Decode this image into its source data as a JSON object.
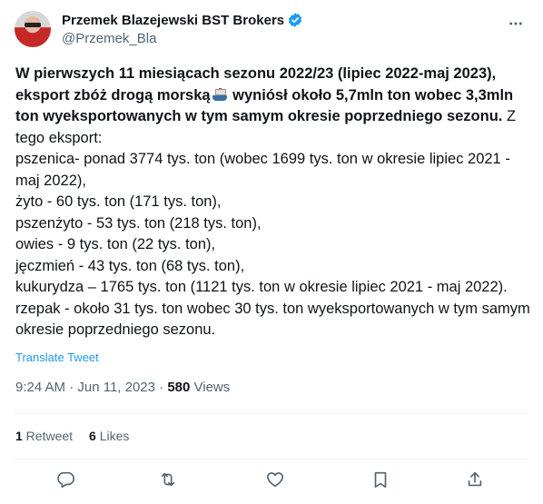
{
  "author": {
    "display_name": "Przemek Blazejewski BST Brokers",
    "handle": "@Przemek_Bla"
  },
  "tweet": {
    "bold_part1": "W pierwszych 11 miesiącach  sezonu 2022/23 (lipiec 2022-maj 2023), eksport zbóż drogą morską",
    "bold_part2": " wyniósł około 5,7mln ton wobec 3,3mln ton wyeksportowanych w tym samym okresie poprzedniego sezonu.",
    "intro_tail": " Z tego eksport:",
    "lines": [
      "pszenica- ponad 3774 tys. ton (wobec 1699 tys. ton w okresie lipiec 2021 - maj 2022),",
      "żyto - 60 tys. ton (171 tys. ton),",
      "pszenżyto - 53 tys. ton (218 tys. ton),",
      "owies - 9 tys. ton (22 tys. ton),",
      "jęczmień - 43 tys. ton (68 tys. ton),",
      "kukurydza – 1765 tys. ton (1121 tys. ton w okresie lipiec 2021 - maj 2022).",
      "rzepak -  około 31 tys. ton wobec 30 tys. ton wyeksportowanych w tym samym okresie poprzedniego sezonu."
    ],
    "emoji": "ship-icon"
  },
  "translate_label": "Translate Tweet",
  "meta": {
    "timestamp": "9:24 AM · Jun 11, 2023 · ",
    "views_count": "580",
    "views_label": " Views"
  },
  "stats": {
    "retweets_count": "1",
    "retweets_label": " Retweet",
    "likes_count": "6",
    "likes_label": " Likes"
  },
  "colors": {
    "accent": "#1d9bf0",
    "secondary_text": "#536471",
    "text": "#0f1419"
  }
}
